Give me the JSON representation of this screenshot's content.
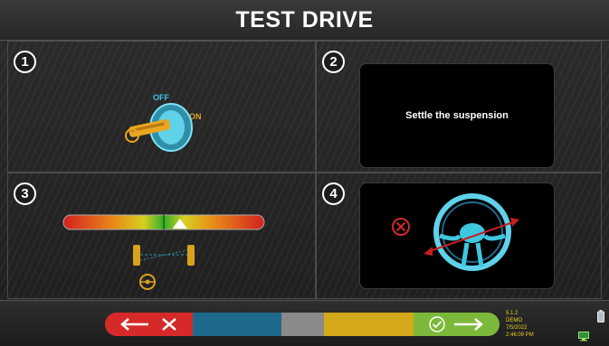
{
  "header": {
    "title": "TEST DRIVE"
  },
  "steps": [
    {
      "number": "1",
      "labels": {
        "off": "OFF",
        "on": "ON"
      }
    },
    {
      "number": "2",
      "message": "Settle the suspension"
    },
    {
      "number": "3"
    },
    {
      "number": "4"
    }
  ],
  "alignment_bar": {
    "indicator_position": 0.58
  },
  "footer": {
    "version": "5.1.2",
    "mode": "DEMO",
    "date": "7/5/2022",
    "time": "2:46:09 PM"
  },
  "colors": {
    "back": "#d62a2a",
    "blue": "#1f6a8c",
    "gray": "#8a8a8a",
    "yellow": "#d3a91b",
    "next": "#7cb93a",
    "accent_cyan": "#3ec7e0"
  },
  "icons": [
    "ignition-key-icon",
    "alignment-bar-icon",
    "axle-icon",
    "steering-wheel-icon",
    "cancel-icon",
    "back-arrow-icon",
    "close-icon",
    "check-icon",
    "next-arrow-icon",
    "battery-icon",
    "monitor-icon"
  ]
}
